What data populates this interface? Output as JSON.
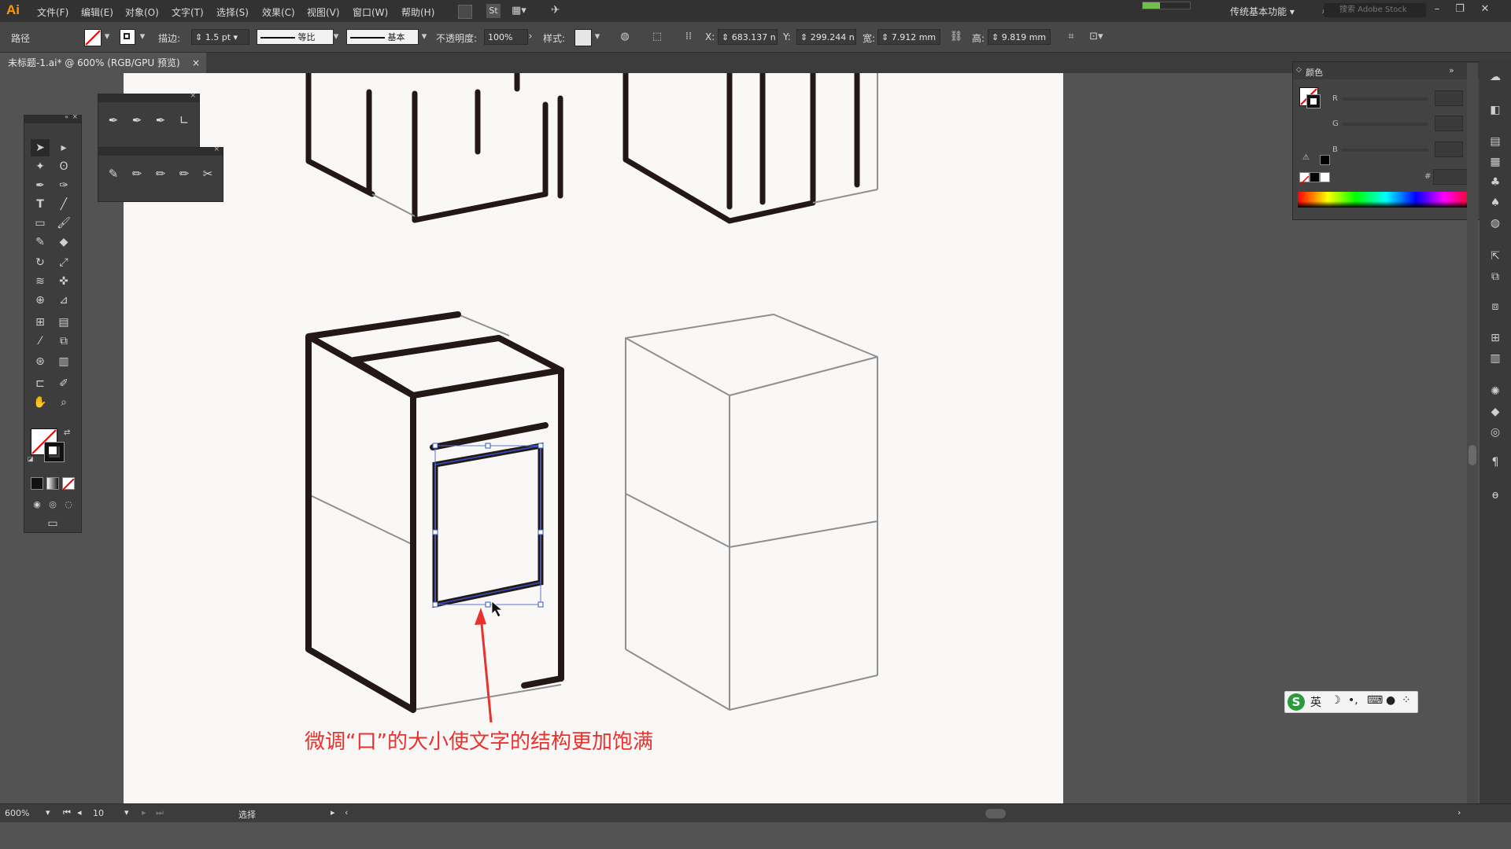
{
  "app": {
    "logo": "Ai",
    "menus": [
      "文件(F)",
      "编辑(E)",
      "对象(O)",
      "文字(T)",
      "选择(S)",
      "效果(C)",
      "视图(V)",
      "窗口(W)",
      "帮助(H)"
    ],
    "st_badge": "St",
    "workspace": "传统基本功能",
    "search_placeholder": "搜索 Adobe Stock"
  },
  "control": {
    "object_type": "路径",
    "stroke_label": "描边:",
    "stroke_weight": "1.5 pt",
    "profile_label": "等比",
    "brush_label": "基本",
    "opacity_label": "不透明度:",
    "opacity_value": "100%",
    "style_label": "样式:",
    "x_label": "X:",
    "x_value": "683.137 n",
    "y_label": "Y:",
    "y_value": "299.244 n",
    "w_label": "宽:",
    "w_value": "7.912 mm",
    "h_label": "高:",
    "h_value": "9.819 mm"
  },
  "document": {
    "tab_title": "未标题-1.ai* @ 600% (RGB/GPU 预览)",
    "close_glyph": "×"
  },
  "annotation": {
    "caption": "微调“口”的大小使文字的结构更加饱满",
    "color": "#e8322d"
  },
  "color_panel": {
    "title": "颜色",
    "channels": [
      "R",
      "G",
      "B"
    ],
    "hex_label": "#"
  },
  "status": {
    "zoom": "600%",
    "page": "10",
    "tool": "选择"
  },
  "ime": {
    "lang": "英",
    "icons": [
      "moon-icon",
      "punctuation-icon",
      "keyboard-icon",
      "user-icon",
      "grid-icon"
    ]
  },
  "colors": {
    "accent": "#ff9a00",
    "selection": "#2f54c9",
    "artwork_stroke": "#231815",
    "guide_stroke": "#8f8f8f",
    "annotation": "#e8322d"
  }
}
